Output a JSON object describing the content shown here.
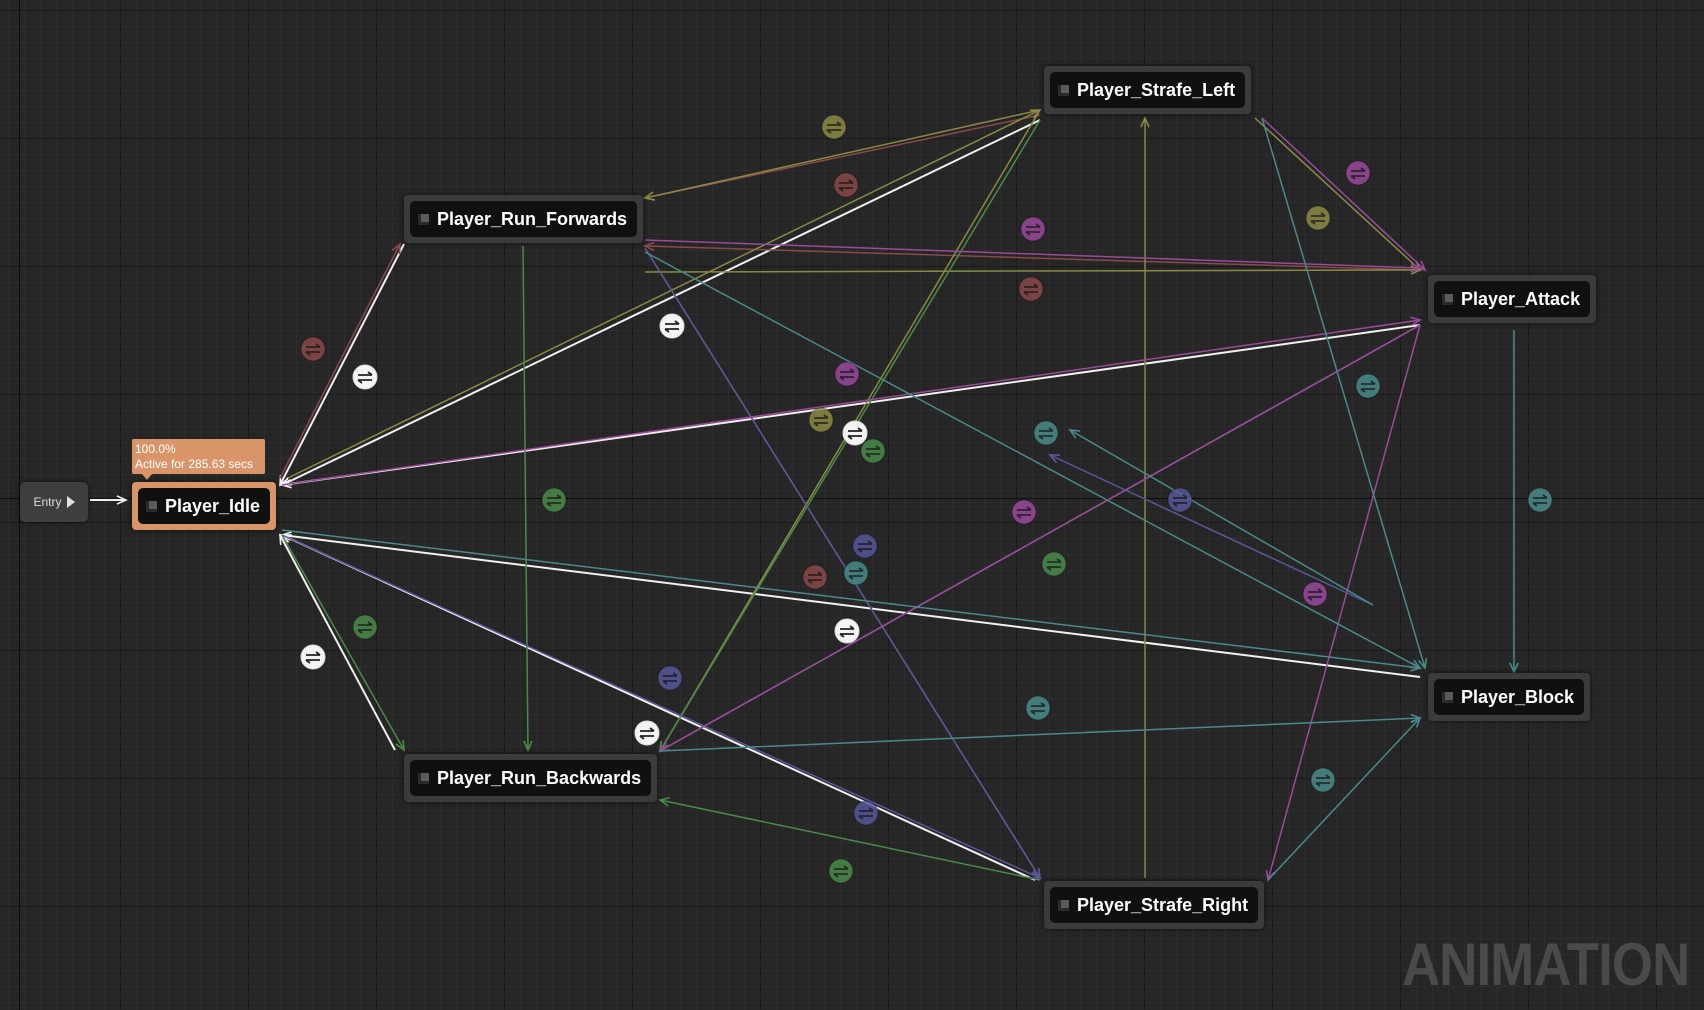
{
  "entry": {
    "label": "Entry"
  },
  "tooltip": {
    "weight": "100.0%",
    "active": "Active for 285.63 secs"
  },
  "states": [
    {
      "id": "idle",
      "label": "Player_Idle",
      "active": true
    },
    {
      "id": "run_forwards",
      "label": "Player_Run_Forwards"
    },
    {
      "id": "run_backwards",
      "label": "Player_Run_Backwards"
    },
    {
      "id": "strafe_left",
      "label": "Player_Strafe_Left"
    },
    {
      "id": "strafe_right",
      "label": "Player_Strafe_Right"
    },
    {
      "id": "attack",
      "label": "Player_Attack"
    },
    {
      "id": "block",
      "label": "Player_Block"
    }
  ],
  "colors": {
    "red": "#8a4a4a",
    "olive": "#8a8a44",
    "green": "#4a8a4a",
    "blue": "#58589a",
    "magenta": "#9a4a9a",
    "teal": "#4a8a8a",
    "white": "#f0f0f0",
    "active_state": "#d8956a"
  },
  "watermark": "ANIMATION",
  "transition_icon": "transition-rule-icon"
}
